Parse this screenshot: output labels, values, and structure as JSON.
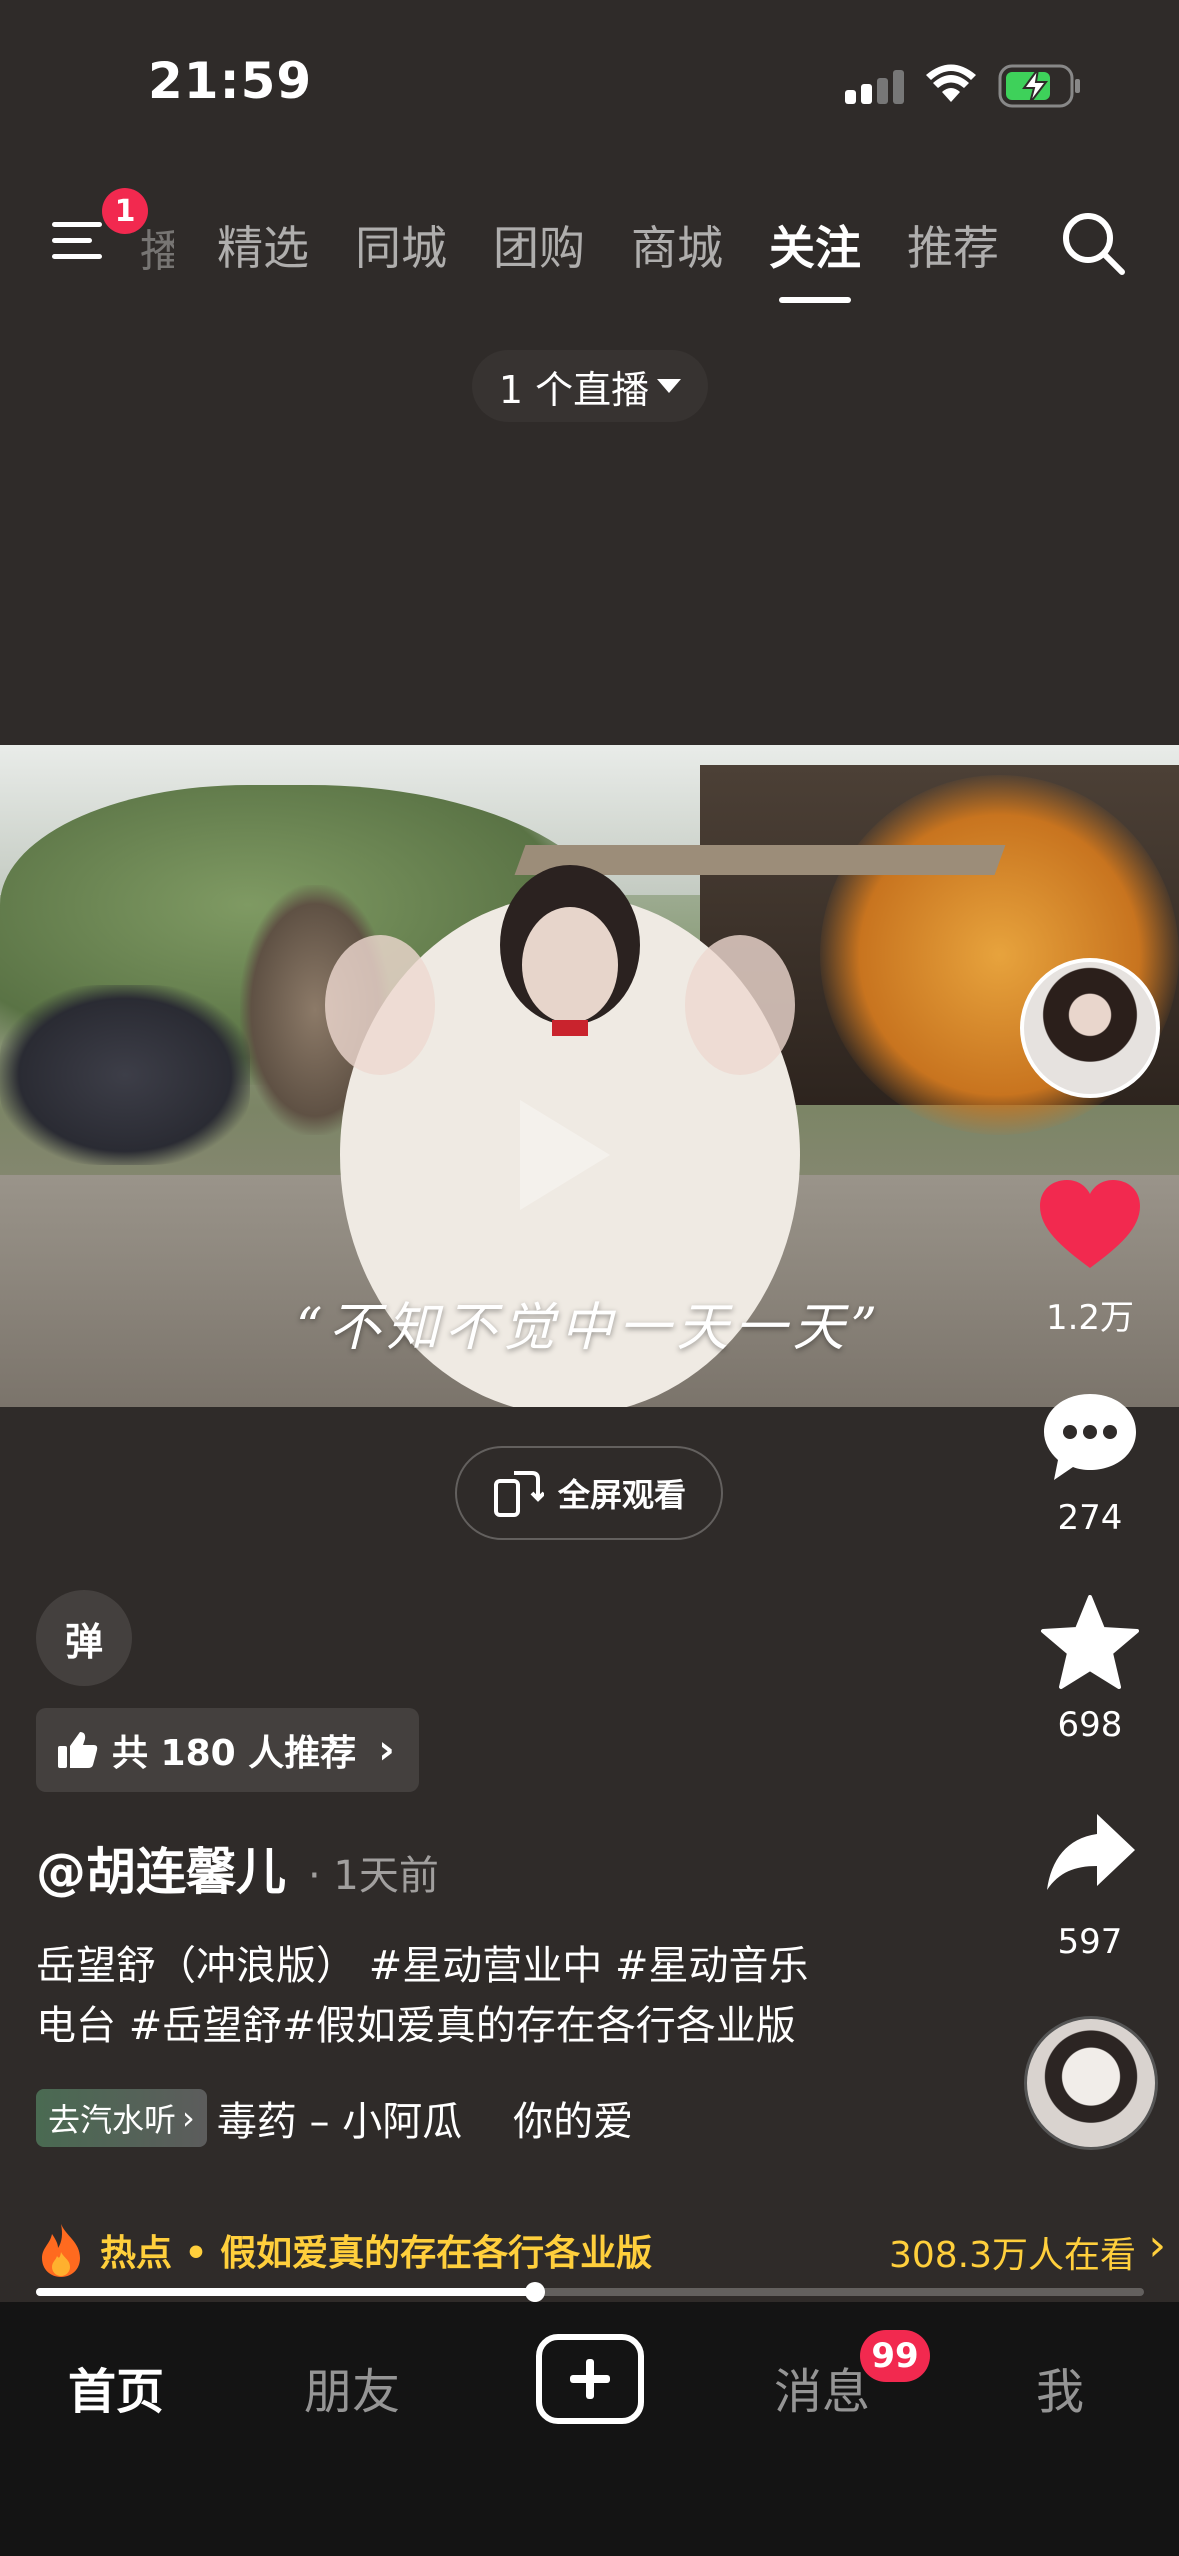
{
  "status_bar": {
    "time": "21:59"
  },
  "top_nav": {
    "menu_badge": "1",
    "cut_tab": "播",
    "tabs": [
      "精选",
      "同城",
      "团购",
      "商城",
      "关注",
      "推荐"
    ],
    "active_tab": "关注"
  },
  "live_pill": {
    "label": "1 个直播"
  },
  "video": {
    "caption": "“不知不觉中一天一天”",
    "fullscreen_label": "全屏观看"
  },
  "actions": {
    "likes": "1.2万",
    "comments": "274",
    "favorites": "698",
    "shares": "597"
  },
  "danmaku_label": "弹",
  "recommend_label": "共 180 人推荐",
  "post": {
    "author": "@胡连馨儿",
    "time": "· 1天前",
    "description_line1": "岳望舒（冲浪版） #星动营业中 #星动音乐",
    "description_line2": "电台 #岳望舒#假如爱真的存在各行各业版"
  },
  "music": {
    "listen_label": "去汽水听",
    "title": "毒药 – 小阿瓜    你的爱"
  },
  "hot": {
    "text": "热点 • 假如爱真的存在各行各业版",
    "viewers": "308.3万人在看"
  },
  "progress": {
    "fraction": 0.45
  },
  "bottom_nav": {
    "home": "首页",
    "friends": "朋友",
    "messages": "消息",
    "messages_badge": "99",
    "me": "我"
  },
  "colors": {
    "accent": "#f2294f",
    "hot": "#ffcf3c",
    "background": "#2f2b29"
  }
}
